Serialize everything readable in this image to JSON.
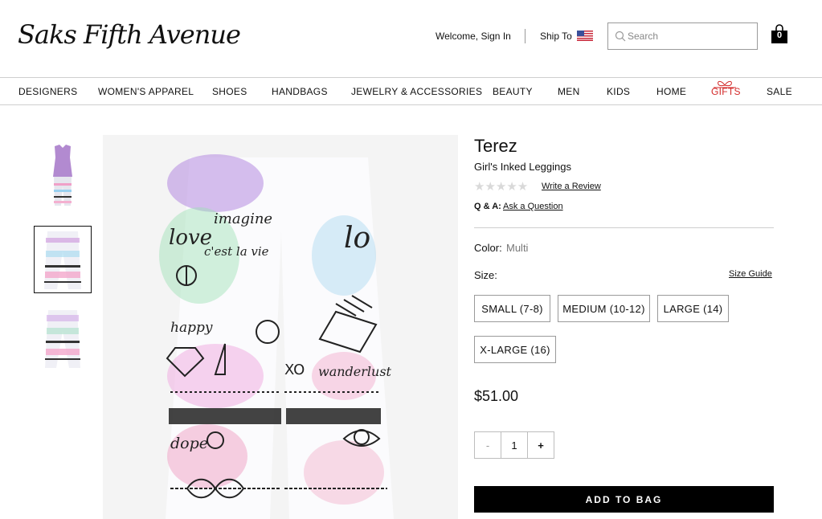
{
  "header": {
    "logo_text": "Saks Fifth Avenue",
    "welcome": "Welcome, Sign In",
    "ship_to": "Ship To",
    "search_placeholder": "Search",
    "bag_count": "0",
    "flag_icon": "us-flag-icon"
  },
  "nav": {
    "items": [
      "DESIGNERS",
      "WOMEN'S APPAREL",
      "SHOES",
      "HANDBAGS",
      "JEWELRY & ACCESSORIES",
      "BEAUTY",
      "MEN",
      "KIDS",
      "HOME",
      "GIFTS",
      "SALE"
    ],
    "gifts_color": "#d32a2a"
  },
  "product": {
    "brand": "Terez",
    "name": "Girl's Inked Leggings",
    "stars": "★★★★★",
    "write_review": "Write a Review",
    "qa_label": "Q & A:",
    "ask_question": "Ask a Question",
    "color_label": "Color:",
    "color_value": "Multi",
    "size_label": "Size:",
    "size_guide": "Size Guide",
    "sizes": [
      "SMALL (7-8)",
      "MEDIUM (10-12)",
      "LARGE (14)",
      "X-LARGE (16)"
    ],
    "price": "$51.00",
    "qty_minus": "-",
    "quantity": "1",
    "qty_plus": "+",
    "add_to_bag": "ADD TO BAG"
  },
  "images": {
    "active_thumbnail_index": 1,
    "print_words": [
      "imagine",
      "c'est la vie",
      "love",
      "happy",
      "wanderlust",
      "dope",
      "XO",
      "lo"
    ]
  }
}
